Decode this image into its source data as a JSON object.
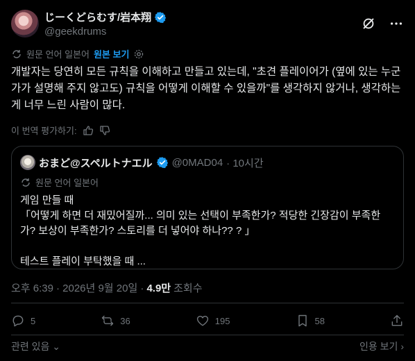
{
  "author": {
    "display_name": "じーくどらむす/岩本翔",
    "handle": "@geekdrums"
  },
  "translation": {
    "source_label": "원문 언어 일본어",
    "show_original": "원본 보기"
  },
  "post_text": "개발자는 당연히 모든 규칙을 이해하고 만들고 있는데, \"초견 플레이어가 (옆에 있는 누군가가 설명해 주지 않고도) 규칙을 어떻게 이해할 수 있을까\"를 생각하지 않거나, 생각하는 게 너무 느린 사람이 많다.",
  "rate_translation": "이 번역 평가하기:",
  "quote": {
    "display_name": "おまど@スペルトナエル",
    "handle": "@0MAD04",
    "time": "· 10시간",
    "translation_label": "원문 언어 일본어",
    "text": "게임 만들 때\n「어떻게 하면 더 재밌어질까... 의미 있는 선택이 부족한가? 적당한 긴장감이 부족한가? 보상이 부족한가? 스토리를 더 넣어야 하나?? ? 」\n\n테스트 플레이 부탁했을 때  ..."
  },
  "meta": {
    "time": "오후 6:39",
    "date": "· 2026년 9월 20일 ·",
    "views_count": "4.9만",
    "views_label": "조회수"
  },
  "actions": {
    "replies": "5",
    "reposts": "36",
    "likes": "195",
    "bookmarks": "58"
  },
  "footer": {
    "related": "관련 있음",
    "quotes": "인용 보기"
  },
  "colors": {
    "background": "#000000",
    "text": "#e7e9ea",
    "muted": "#71767b",
    "accent": "#1d9bf0",
    "border": "#2f3336"
  }
}
